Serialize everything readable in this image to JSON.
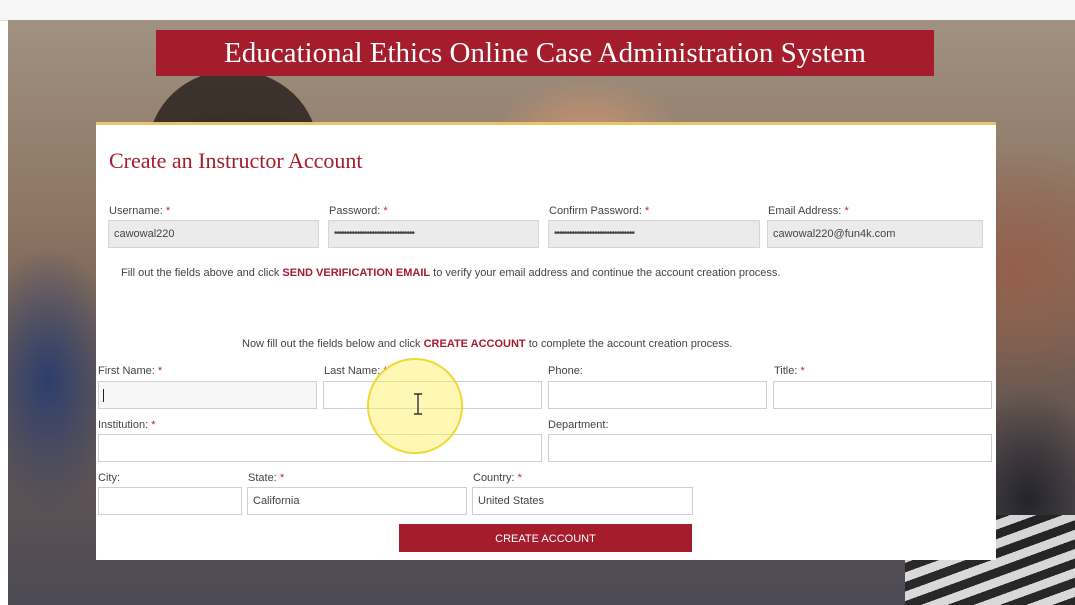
{
  "page": {
    "banner_title": "Educational Ethics Online Case Administration System"
  },
  "form": {
    "heading": "Create an Instructor Account",
    "required_marker": "*",
    "account": {
      "username_label": "Username:",
      "username_value": "cawowal220",
      "password_label": "Password:",
      "password_value": "••••••••••••••••••••••••••••••••",
      "confirm_label": "Confirm Password:",
      "confirm_value": "••••••••••••••••••••••••••••••••",
      "email_label": "Email Address:",
      "email_value": "cawowal220@fun4k.com"
    },
    "verify_note": {
      "before": "Fill out the fields above and click ",
      "action": "SEND VERIFICATION EMAIL",
      "after": " to verify your email address and continue the account creation process."
    },
    "create_note": {
      "before": "Now fill out the fields below and click ",
      "action": "CREATE ACCOUNT",
      "after": " to complete the account creation process."
    },
    "details": {
      "first_name_label": "First Name:",
      "first_name_value": "",
      "last_name_label": "Last Name:",
      "last_name_value": "",
      "phone_label": "Phone:",
      "phone_value": "",
      "title_label": "Title:",
      "title_value": "",
      "institution_label": "Institution:",
      "institution_value": "",
      "department_label": "Department:",
      "department_value": "",
      "city_label": "City:",
      "city_value": "",
      "state_label": "State:",
      "state_value": "California",
      "country_label": "Country:",
      "country_value": "United States"
    },
    "create_button_label": "CREATE ACCOUNT"
  },
  "icons": {
    "text_cursor": "i-beam-cursor-icon"
  },
  "colors": {
    "brand": "#a51c2c",
    "accent_border": "#e8c46a",
    "required": "#c1272d"
  }
}
